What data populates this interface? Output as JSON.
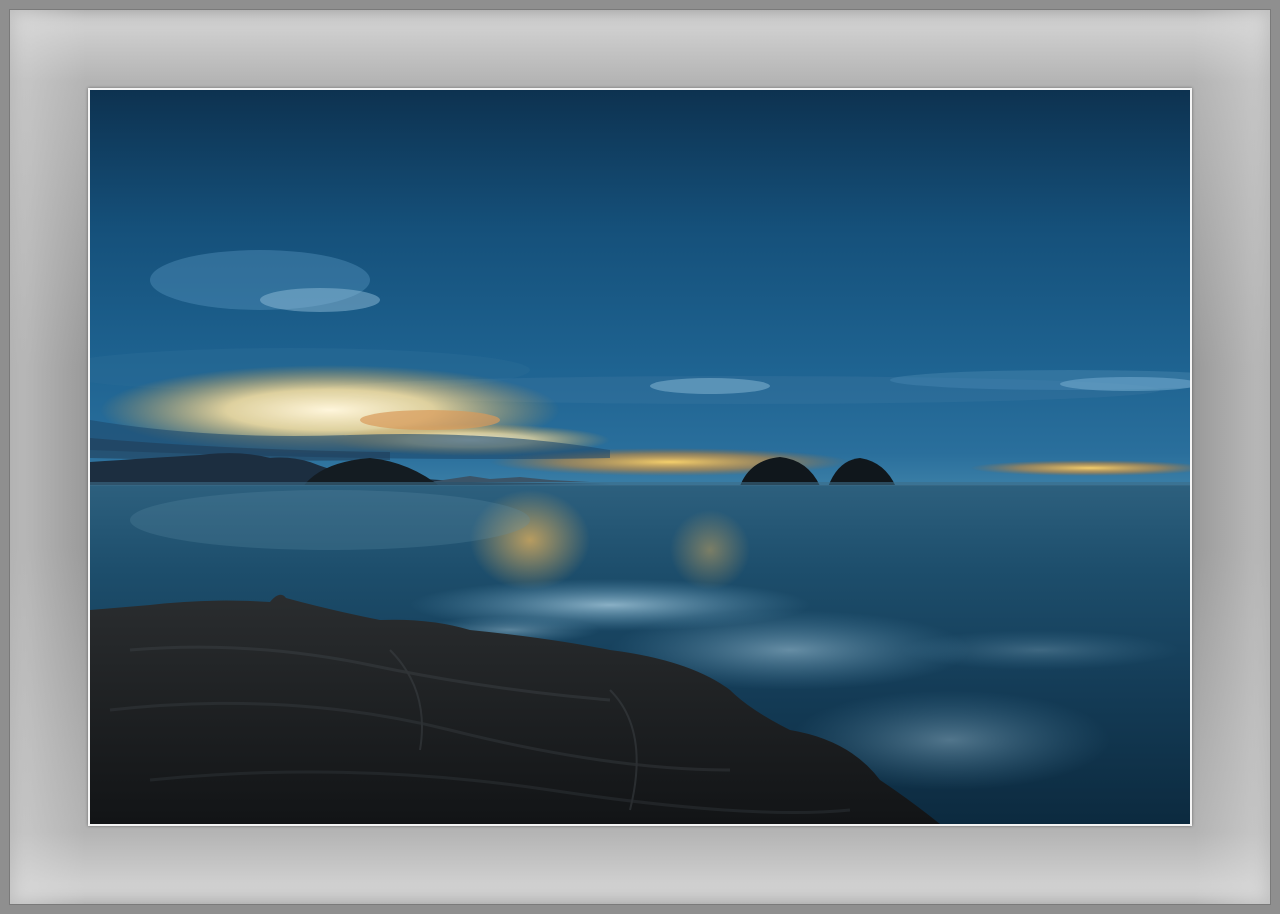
{
  "scene": {
    "subject": "seascape-at-dusk",
    "colors": {
      "sky_top": "#0e3552",
      "sky_mid": "#1b5f88",
      "sky_horizon": "#2d7fae",
      "sunset_glow": "#f2b23a",
      "sunset_core": "#fff2c6",
      "sea_dark": "#0e2f45",
      "sea_light": "#2c6c8c",
      "rock": "#1c2023",
      "mat": "#9a9a9a"
    }
  }
}
